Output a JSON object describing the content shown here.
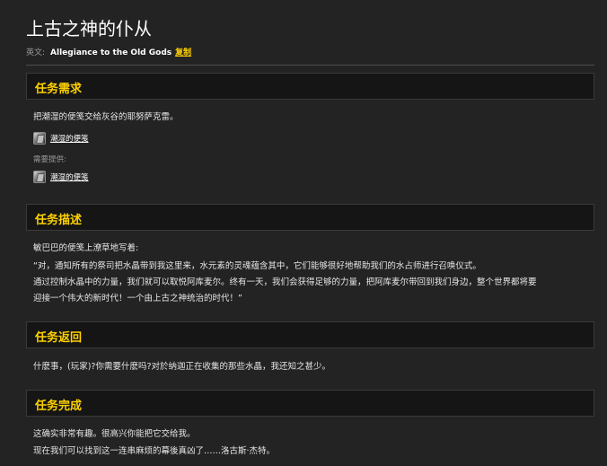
{
  "page": {
    "title": "上古之神的仆从",
    "english_label": "英文:",
    "english_name": "Allegiance to the Old Gods",
    "copy_label": "复制"
  },
  "requirements": {
    "header": "任务需求",
    "text": "把潮湿的便笺交给灰谷的耶努萨克雷。",
    "item_name": "潮湿的便笺",
    "provided_label": "需要提供:",
    "provided_item_name": "潮湿的便笺"
  },
  "description": {
    "header": "任务描述",
    "lines": [
      "敏巴巴的便笺上潦草地写着:",
      "“对，通知所有的祭司把水晶带到我这里来，水元素的灵魂蕴含其中，它们能够很好地帮助我们的水占师进行召唤仪式。",
      "通过控制水晶中的力量，我们就可以取悦阿库麦尔。终有一天，我们会获得足够的力量，把阿库麦尔带回到我们身边，整个世界都将要",
      "迎接一个伟大的新时代！一个由上古之神统治的时代！”"
    ]
  },
  "return": {
    "header": "任务返回",
    "text": "什麽事，(玩家)?你需要什麽吗?对於纳迦正在收集的那些水晶，我还知之甚少。"
  },
  "completion": {
    "header": "任务完成",
    "lines": [
      "这确实非常有趣。很高兴你能把它交给我。",
      "现在我们可以找到这一连串麻烦的幕後真凶了……洛古斯·杰特。"
    ]
  }
}
